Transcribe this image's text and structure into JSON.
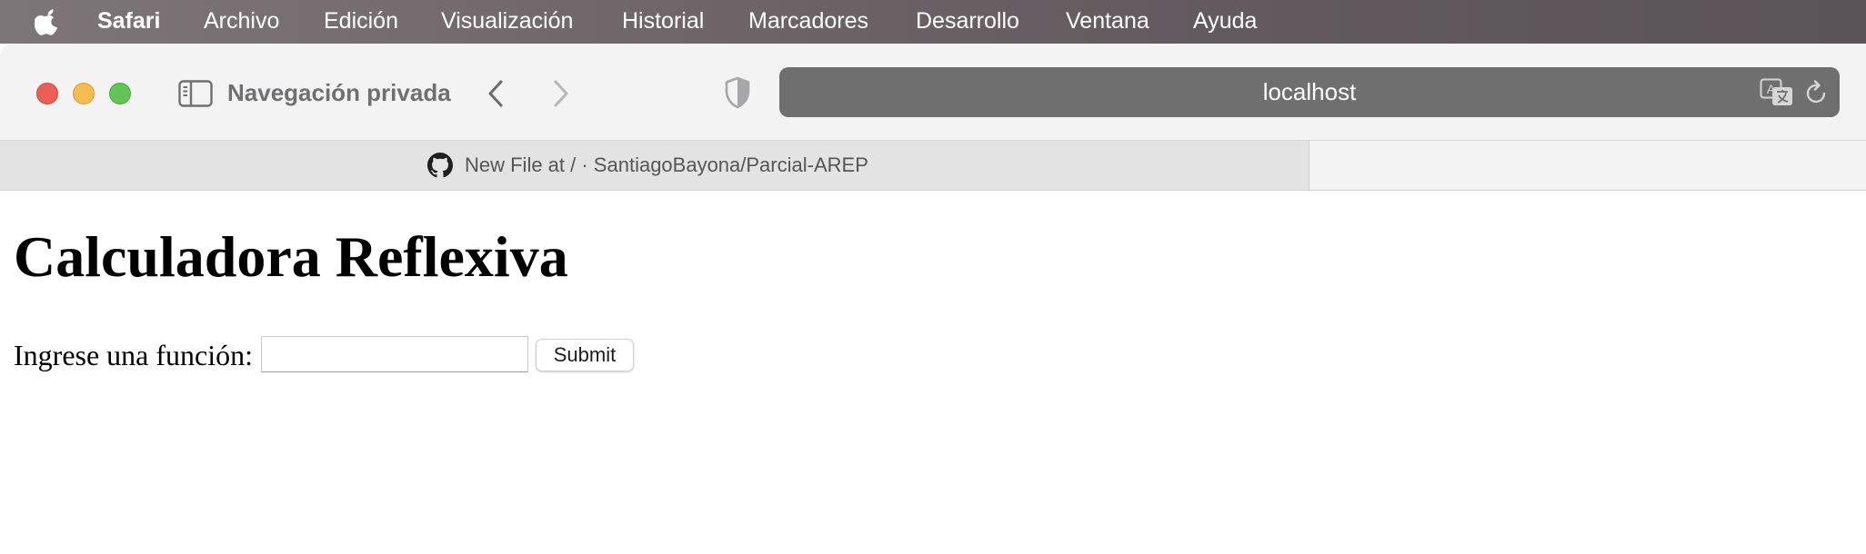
{
  "menubar": {
    "apple_icon": "apple-logo-icon",
    "app_name": "Safari",
    "items": [
      "Archivo",
      "Edición",
      "Visualización",
      "Historial",
      "Marcadores",
      "Desarrollo",
      "Ventana",
      "Ayuda"
    ]
  },
  "toolbar": {
    "sidebar_icon": "sidebar-icon",
    "private_label": "Navegación privada",
    "back_icon": "chevron-left-icon",
    "forward_icon": "chevron-right-icon",
    "privacy_icon": "shield-icon",
    "url": "localhost",
    "translate_icon": "translate-icon",
    "reload_icon": "reload-icon"
  },
  "tabs": [
    {
      "icon": "github-icon",
      "title": "New File at / · SantiagoBayona/Parcial-AREP",
      "active": false
    }
  ],
  "page": {
    "title": "Calculadora Reflexiva",
    "form": {
      "label": "Ingrese una función:",
      "input_value": "",
      "submit_label": "Submit"
    }
  },
  "colors": {
    "close": "#ec5f57",
    "minimize": "#f3bd4f",
    "maximize": "#61c454",
    "urlbar_bg": "#6f6f70",
    "toolbar_bg": "#f4f3f3"
  }
}
